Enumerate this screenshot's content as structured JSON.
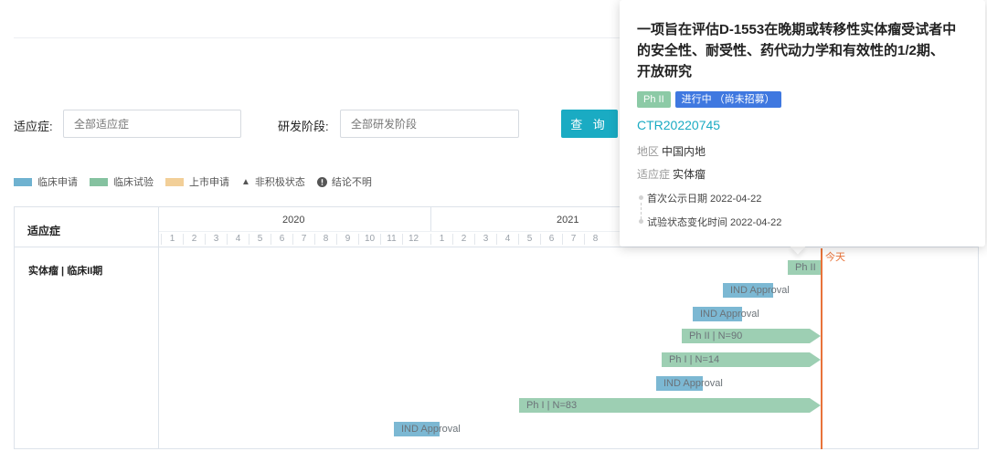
{
  "filters": {
    "indication_label": "适应症:",
    "indication_placeholder": "全部适应症",
    "phase_label": "研发阶段:",
    "phase_placeholder": "全部研发阶段",
    "query_label": "查 询"
  },
  "legend": {
    "items": [
      {
        "label": "临床申请",
        "color": "#6fb2d0",
        "icon": "swatch"
      },
      {
        "label": "临床试验",
        "color": "#85c2a0",
        "icon": "swatch"
      },
      {
        "label": "上市申请",
        "color": "#f2cf98",
        "icon": "swatch"
      },
      {
        "label": "非积极状态",
        "icon": "triangle-icon"
      },
      {
        "label": "结论不明",
        "icon": "exclamation-circle-icon"
      }
    ]
  },
  "gantt": {
    "indication_header": "适应症",
    "years": [
      "2020",
      "2021"
    ],
    "months_2020": [
      "1",
      "2",
      "3",
      "4",
      "5",
      "6",
      "7",
      "8",
      "9",
      "10",
      "11",
      "12"
    ],
    "months_2021": [
      "1",
      "2",
      "3",
      "4",
      "5",
      "6",
      "7",
      "8"
    ],
    "row_label": "实体瘤 | 临床II期",
    "today_label": "今天",
    "bars": [
      {
        "label": "Ph II",
        "color": "#9dcfb3"
      },
      {
        "label": "IND Approval",
        "color": "#7cb8d3"
      },
      {
        "label": "IND Approval",
        "color": "#7cb8d3"
      },
      {
        "label": "Ph II | N=90",
        "color": "#9dcfb3"
      },
      {
        "label": "Ph I | N=14",
        "color": "#9dcfb3"
      },
      {
        "label": "IND Approval",
        "color": "#7cb8d3"
      },
      {
        "label": "Ph I | N=83",
        "color": "#9dcfb3"
      },
      {
        "label": "IND Approval",
        "color": "#7cb8d3"
      }
    ]
  },
  "tooltip": {
    "title": "一项旨在评估D-1553在晚期或转移性实体瘤受试者中的安全性、耐受性、药代动力学和有效性的1/2期、开放研究",
    "phase_badge": "Ph II",
    "status_badge": "进行中 （尚未招募）",
    "trial_id": "CTR20220745",
    "region_label": "地区",
    "region_value": "中国内地",
    "indication_label": "适应症",
    "indication_value": "实体瘤",
    "first_publish": "首次公示日期 2022-04-22",
    "status_change": "试验状态变化时间 2022-04-22"
  },
  "colors": {
    "accent": "#1aabc3",
    "today": "#e8733a",
    "status_badge": "#3f78e0"
  }
}
